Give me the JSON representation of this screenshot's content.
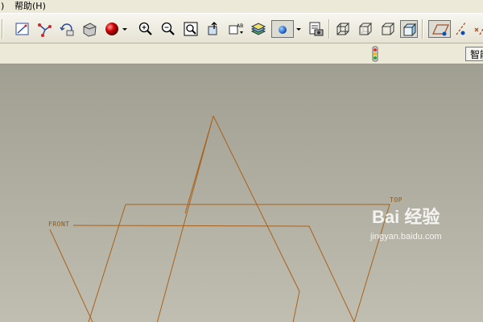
{
  "menubar": {
    "partial_paren": ")",
    "help_label": "帮助(H)"
  },
  "toolbar": {
    "buttons": [
      {
        "name": "sketch-icon"
      },
      {
        "name": "datum-axis-icon"
      },
      {
        "name": "regenerate-icon"
      },
      {
        "name": "shading-icon"
      },
      {
        "name": "red-sphere-icon"
      },
      {
        "name": "zoom-in-icon"
      },
      {
        "name": "zoom-out-icon"
      },
      {
        "name": "refit-icon"
      },
      {
        "name": "reorient-icon"
      },
      {
        "name": "view-manager-icon"
      },
      {
        "name": "layers-icon"
      },
      {
        "name": "saved-views-icon"
      },
      {
        "name": "display-style-icon"
      },
      {
        "name": "wireframe-icon"
      },
      {
        "name": "hidden-line-icon"
      },
      {
        "name": "no-hidden-icon"
      },
      {
        "name": "shaded-icon"
      },
      {
        "name": "datum-plane-display-icon"
      },
      {
        "name": "datum-axis-display-icon"
      }
    ]
  },
  "status": {
    "smart_label": "智能"
  },
  "viewport": {
    "labels": {
      "front": "FRONT",
      "top": "TOP"
    },
    "line_color": "#a8621d"
  },
  "watermark": {
    "logo": "Bai 经验",
    "url": "jingyan.baidu.com"
  }
}
